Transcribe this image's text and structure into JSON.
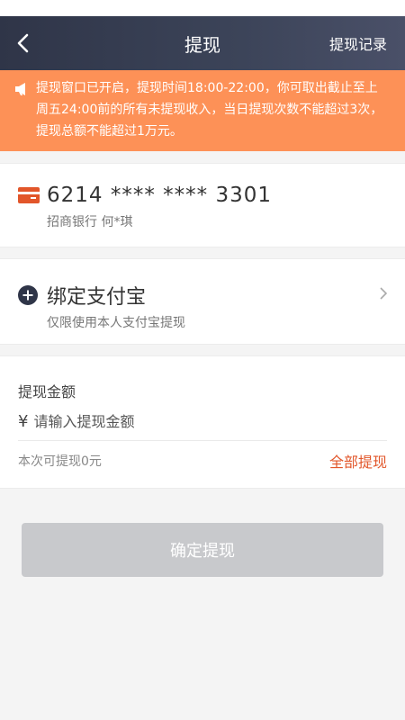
{
  "nav": {
    "title": "提现",
    "record_label": "提现记录"
  },
  "notice": {
    "text": "提现窗口已开启，提现时间18:00-22:00，你可取出截止至上周五24:00前的所有未提现收入，当日提现次数不能超过3次，提现总额不能超过1万元。"
  },
  "bank_card": {
    "number": "6214 **** **** 3301",
    "bank_and_holder": "招商银行 何*琪",
    "icon": "bank-card-icon",
    "icon_color": "#e2562a"
  },
  "alipay": {
    "title": "绑定支付宝",
    "subtitle": "仅限使用本人支付宝提现",
    "icon": "plus-circle-icon"
  },
  "amount": {
    "label": "提现金额",
    "currency_symbol": "¥",
    "placeholder": "请输入提现金额",
    "value": "",
    "available_text": "本次可提现0元",
    "withdraw_all_label": "全部提现"
  },
  "confirm_button": {
    "label": "确定提现",
    "enabled": false
  },
  "colors": {
    "nav_bg": "#343b4f",
    "notice_bg": "#fd9157",
    "accent": "#e2562a",
    "button_disabled": "#c8c9cc"
  }
}
